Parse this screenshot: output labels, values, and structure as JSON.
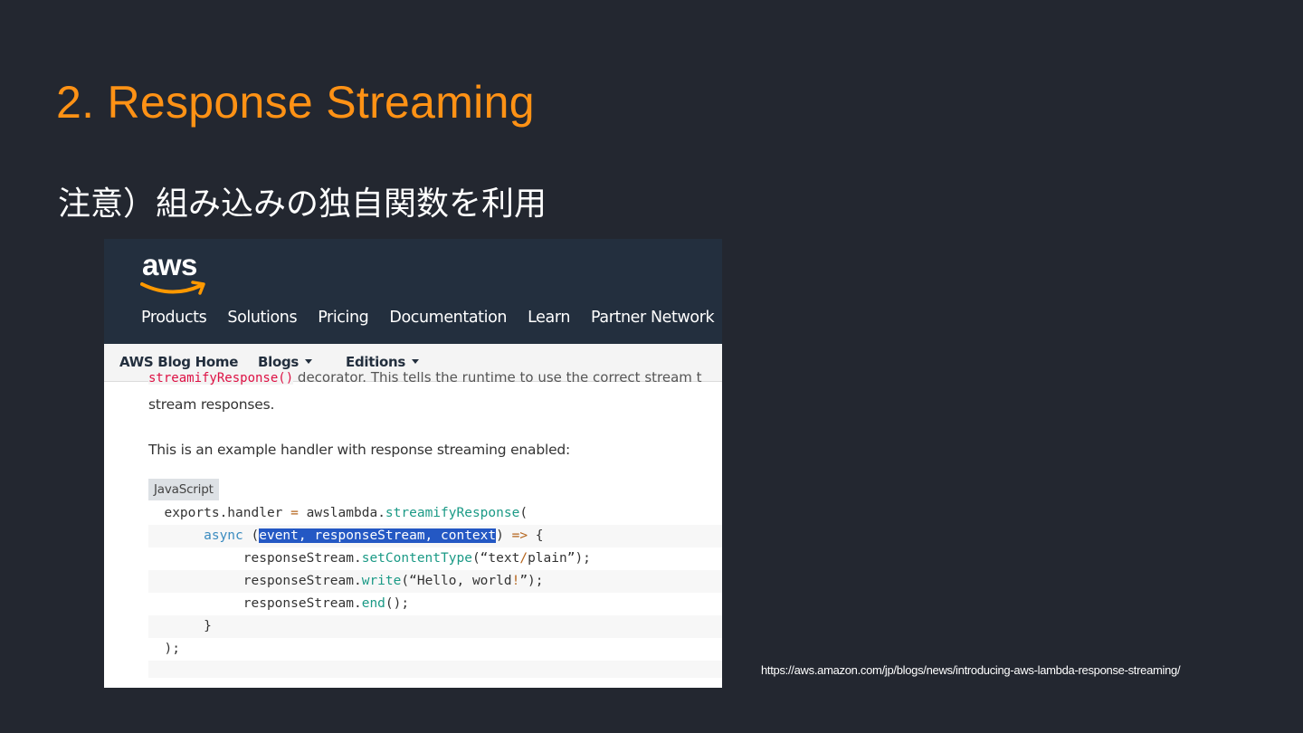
{
  "slide": {
    "title": "2. Response Streaming",
    "subtitle": "注意）組み込みの独自関数を利用",
    "source_url": "https://aws.amazon.com/jp/blogs/news/introducing-aws-lambda-response-streaming/"
  },
  "aws": {
    "logo_text": "aws",
    "nav": [
      "Products",
      "Solutions",
      "Pricing",
      "Documentation",
      "Learn",
      "Partner Network"
    ]
  },
  "blog_nav": {
    "home": "AWS Blog Home",
    "blogs": "Blogs",
    "editions": "Editions"
  },
  "article": {
    "cut_code": "streamifyResponse()",
    "cut_text": " decorator. This tells the runtime to use the correct stream t",
    "line1": "stream responses.",
    "line2": "This is an example handler with response streaming enabled:",
    "code_lang": "JavaScript",
    "code": {
      "l1_a": "exports.handler ",
      "l1_op": "=",
      "l1_b": " awslambda.",
      "l1_fn": "streamifyResponse",
      "l1_c": "(",
      "l2_kw": "async",
      "l2_a": " (",
      "l2_sel": "event, responseStream, context",
      "l2_b": ") ",
      "l2_op": "=>",
      "l2_c": " {",
      "l3_a": "responseStream.",
      "l3_fn": "setContentType",
      "l3_b": "(“text",
      "l3_op": "/",
      "l3_c": "plain”);",
      "l4_a": "responseStream.",
      "l4_fn": "write",
      "l4_b": "(“Hello, world",
      "l4_op": "!",
      "l4_c": "”);",
      "l5_a": "responseStream.",
      "l5_fn": "end",
      "l5_b": "();",
      "l6": "}",
      "l7": ");"
    }
  },
  "colors": {
    "background": "#232730",
    "title": "#ff9215",
    "aws_header": "#232f3e",
    "selection": "#2458c4"
  }
}
